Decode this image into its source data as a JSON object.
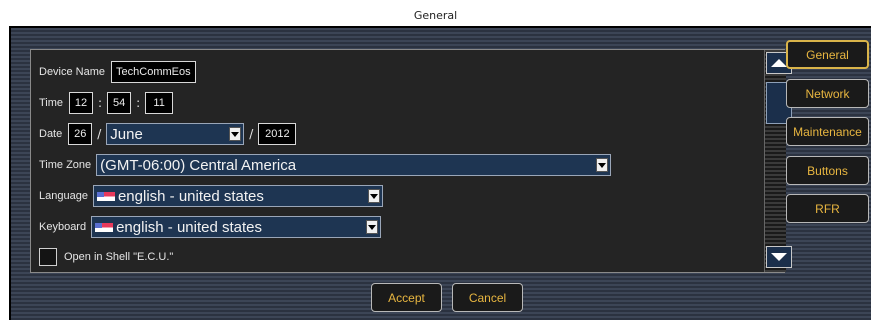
{
  "window": {
    "title": "General"
  },
  "form": {
    "device_name_label": "Device Name",
    "device_name_value": "TechCommEos",
    "time_label": "Time",
    "time_hours": "12",
    "time_minutes": "54",
    "time_seconds": "11",
    "time_sep": ":",
    "date_label": "Date",
    "date_day": "26",
    "date_month": "June",
    "date_year": "2012",
    "date_sep": "/",
    "timezone_label": "Time Zone",
    "timezone_value": "(GMT-06:00) Central America",
    "language_label": "Language",
    "language_value": "english - united states",
    "keyboard_label": "Keyboard",
    "keyboard_value": "english - united states",
    "shell_label": "Open in Shell \"E.C.U.\""
  },
  "side_buttons": [
    "General",
    "Network",
    "Maintenance",
    "Buttons",
    "RFR"
  ],
  "actions": {
    "accept": "Accept",
    "cancel": "Cancel"
  },
  "colors": {
    "button_text": "#e8b640",
    "field_bg": "#1e3552",
    "panel_bg": "#242424"
  },
  "icons": {
    "scroll_up": "triangle-up",
    "scroll_down": "triangle-down",
    "flag": "us-flag"
  }
}
